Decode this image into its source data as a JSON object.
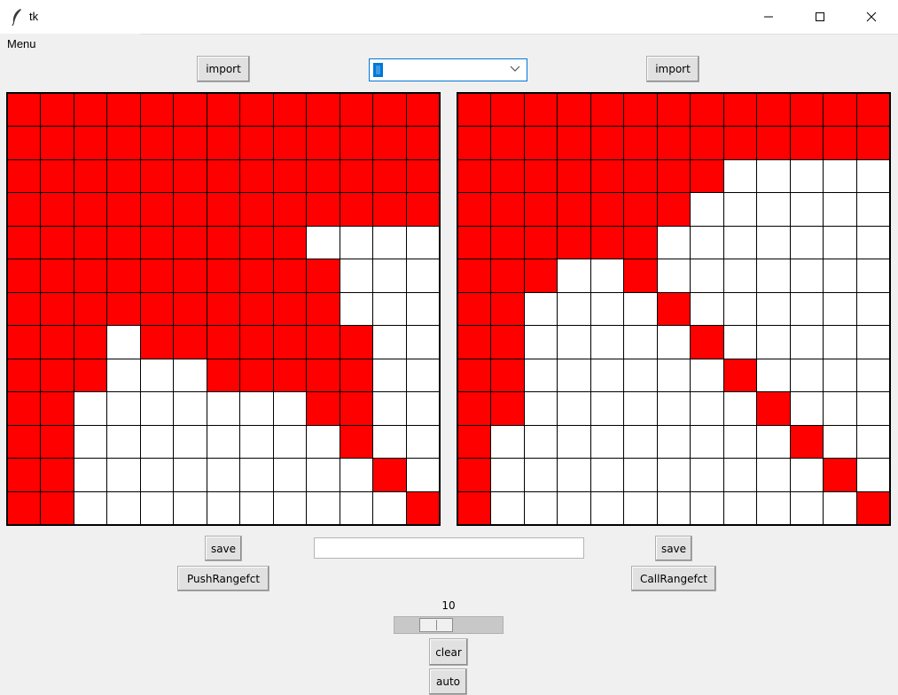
{
  "window": {
    "title": "tk",
    "icon": "feather-icon",
    "controls": [
      "minimize-icon",
      "maximize-icon",
      "close-icon"
    ]
  },
  "menubar": {
    "menu_label": "Menu"
  },
  "left_panel": {
    "import_label": "import",
    "save_label": "save",
    "action_label": "PushRangefct",
    "grid": [
      "1111111111111",
      "1111111111111",
      "1111111111111",
      "1111111111111",
      "1111111110000",
      "1111111111000",
      "1111111111000",
      "1110111111100",
      "1110001111100",
      "1100000001100",
      "1100000000100",
      "1100000000010",
      "1100000000001"
    ]
  },
  "right_panel": {
    "import_label": "import",
    "save_label": "save",
    "action_label": "CallRangefct",
    "grid": [
      "1111111111111",
      "1111111111111",
      "1111111100000",
      "1111111000000",
      "1111110000000",
      "1110010000000",
      "1100001000000",
      "1100000100000",
      "1100000010000",
      "1100000001000",
      "1000000000100",
      "1000000000010",
      "1000000000001"
    ]
  },
  "combo": {
    "value": ""
  },
  "entry": {
    "value": ""
  },
  "scale": {
    "value": "10",
    "level_fraction": 0.33
  },
  "controls": {
    "clear_label": "clear",
    "auto_label": "auto"
  },
  "colors": {
    "active_cell": "#ff0000",
    "inactive_cell": "#ffffff",
    "accent": "#0078d7"
  }
}
